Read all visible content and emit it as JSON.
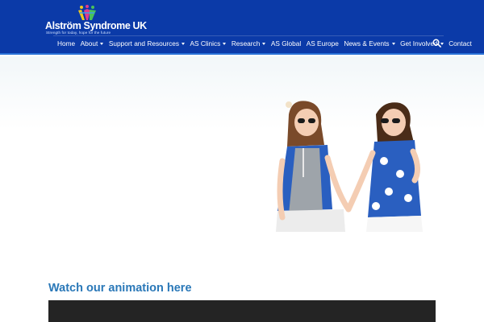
{
  "brand": {
    "name": "Alström Syndrome UK",
    "tagline": "Strength for today, hope for the future",
    "colors": {
      "header": "#0b3aa8",
      "accent": "#2a73d8",
      "link": "#2a78b8"
    }
  },
  "nav": {
    "items": [
      {
        "label": "Home",
        "dropdown": false
      },
      {
        "label": "About",
        "dropdown": true
      },
      {
        "label": "Support and Resources",
        "dropdown": true
      },
      {
        "label": "AS Clinics",
        "dropdown": true
      },
      {
        "label": "Research",
        "dropdown": true
      },
      {
        "label": "AS Global",
        "dropdown": false
      },
      {
        "label": "AS Europe",
        "dropdown": false
      },
      {
        "label": "News & Events",
        "dropdown": true
      },
      {
        "label": "Get Involved",
        "dropdown": true
      },
      {
        "label": "Contact",
        "dropdown": false
      }
    ],
    "search_icon": "search-icon"
  },
  "main": {
    "section_title": "Watch our animation here"
  }
}
